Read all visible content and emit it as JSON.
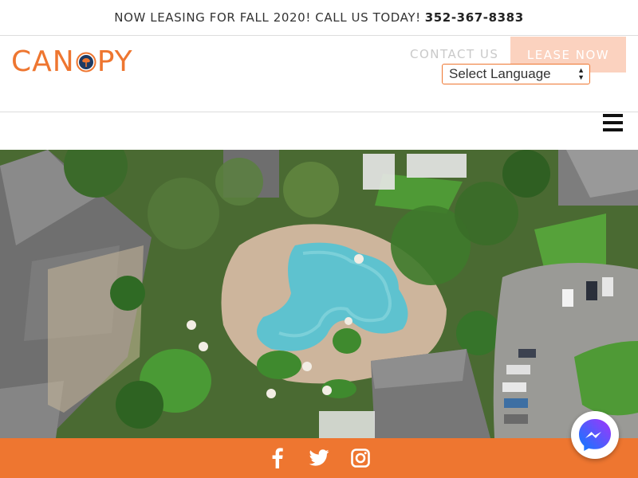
{
  "announcement": {
    "text": "NOW LEASING FOR FALL 2020! CALL US TODAY!",
    "phone": "352-367-8383"
  },
  "header": {
    "logo_text_left": "CAN",
    "logo_text_right": "PY",
    "contact_label": "CONTACT US",
    "lease_label": "LEASE NOW",
    "language_select": "Select Language"
  },
  "icons": {
    "menu": "hamburger-menu-icon",
    "facebook": "facebook-icon",
    "twitter": "twitter-icon",
    "instagram": "instagram-icon",
    "messenger": "messenger-icon"
  },
  "colors": {
    "brand_orange": "#ee7630",
    "lease_button": "#fbd2bf",
    "messenger_blue": "#0084ff"
  }
}
